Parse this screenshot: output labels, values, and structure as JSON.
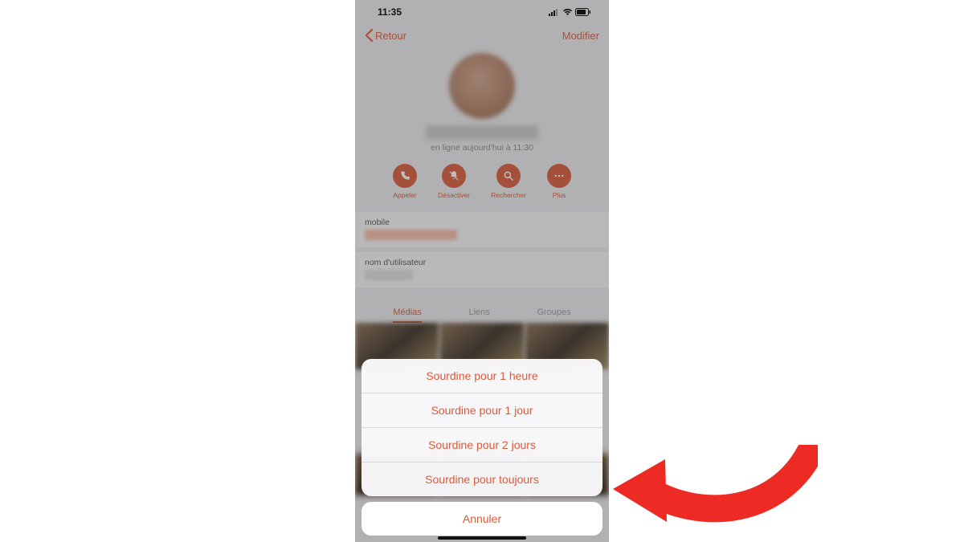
{
  "status": {
    "time": "11:35"
  },
  "nav": {
    "back": "Retour",
    "edit": "Modifier"
  },
  "presence": "en ligne aujourd'hui à 11:30",
  "actions": {
    "call": "Appeler",
    "mute": "Désactiver",
    "search": "Rechercher",
    "more": "Plus"
  },
  "sections": {
    "mobile": "mobile",
    "username": "nom d'utilisateur"
  },
  "tabs": {
    "media": "Médias",
    "links": "Liens",
    "groups": "Groupes"
  },
  "sheet": {
    "options": [
      "Sourdine pour 1 heure",
      "Sourdine pour 1 jour",
      "Sourdine pour 2 jours",
      "Sourdine pour toujours"
    ],
    "cancel": "Annuler"
  },
  "colors": {
    "accent": "#df5a38"
  }
}
